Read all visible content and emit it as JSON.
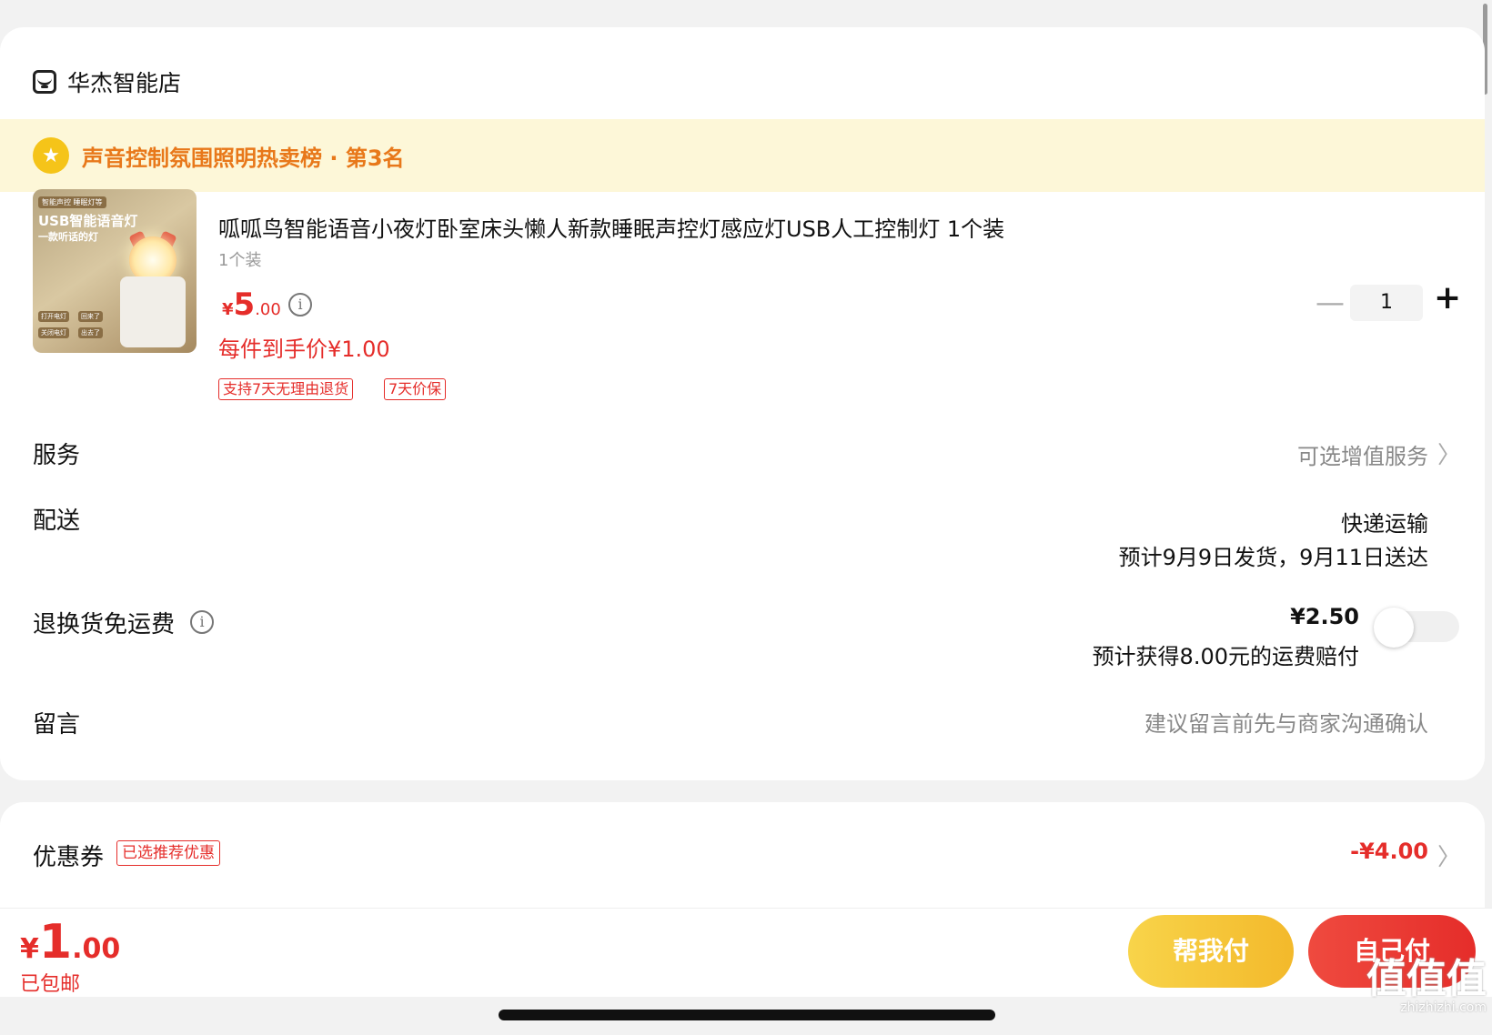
{
  "store": {
    "name": "华杰智能店",
    "icon": "store-icon"
  },
  "rank": {
    "text": "声音控制氛围照明热卖榜 · 第3名",
    "icon": "trophy-icon"
  },
  "product": {
    "image_texts": {
      "tag": "智能声控 睡眠灯等",
      "title": "USB智能语音灯",
      "subtitle": "一款听话的灯",
      "buttons": [
        "打开电灯",
        "回来了",
        "关闭电灯",
        "出去了"
      ]
    },
    "title": "呱呱鸟智能语音小夜灯卧室床头懒人新款睡眠声控灯感应灯USB人工控制灯 1个装",
    "variant": "1个装",
    "price": {
      "currency": "¥",
      "integer": "5",
      "decimal": ".00"
    },
    "final_price": "每件到手价¥1.00",
    "badges": [
      "支持7天无理由退货",
      "7天价保"
    ],
    "quantity": "1"
  },
  "rows": {
    "service": {
      "label": "服务",
      "value": "可选增值服务"
    },
    "delivery": {
      "label": "配送",
      "method": "快递运输",
      "estimate": "预计9月9日发货，9月11日送达"
    },
    "return_shipping": {
      "label": "退换货免运费",
      "price": "¥2.50",
      "note": "预计获得8.00元的运费赔付",
      "toggle_on": false
    },
    "message": {
      "label": "留言",
      "placeholder": "建议留言前先与商家沟通确认"
    }
  },
  "coupon": {
    "label": "优惠券",
    "tag": "已选推荐优惠",
    "value": "-¥4.00"
  },
  "footer": {
    "total": {
      "currency": "¥",
      "integer": "1",
      "decimal": ".00"
    },
    "shipping_note": "已包邮",
    "help_pay": "帮我付",
    "self_pay": "自己付"
  },
  "watermark": {
    "big": "值值值",
    "small": "zhizhizhi.com"
  },
  "colors": {
    "accent": "#e52d2a",
    "rank_bg": "#fdf7d8",
    "rank_text": "#e8781a",
    "help_btn": "#f5c73a"
  }
}
